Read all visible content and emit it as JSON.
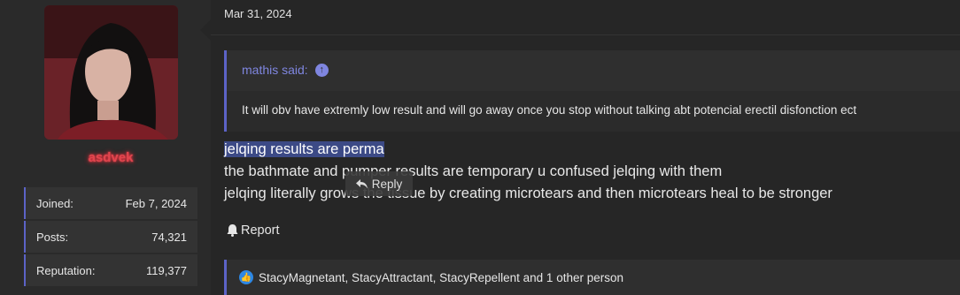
{
  "user": {
    "username": "asdvek",
    "stats": [
      {
        "label": "Joined:",
        "value": "Feb 7, 2024"
      },
      {
        "label": "Posts:",
        "value": "74,321"
      },
      {
        "label": "Reputation:",
        "value": "119,377"
      }
    ]
  },
  "post": {
    "date": "Mar 31, 2024",
    "quote": {
      "author": "mathis said:",
      "text": "It will obv have extremly low result and will go away once you stop without talking abt potencial erectil disfonction ect"
    },
    "lines": [
      "jelqing results are perma",
      "the bathmate and pumper results are temporary u confused jelqing with them",
      "jelqing literally grows the tissue by creating microtears and then microtears heal to be stronger"
    ],
    "reply_popup_label": "Reply",
    "report_label": "Report",
    "reactions_text": "StacyMagnetant, StacyAttractant, StacyRepellent and 1 other person"
  },
  "colors": {
    "accent": "#5c63c7",
    "username_glow": "#e0464e",
    "highlight": "#3c4a86",
    "like": "#2d88e5"
  },
  "icons": [
    "up-arrow-circle-icon",
    "reply-arrow-icon",
    "bell-icon",
    "like-icon"
  ]
}
